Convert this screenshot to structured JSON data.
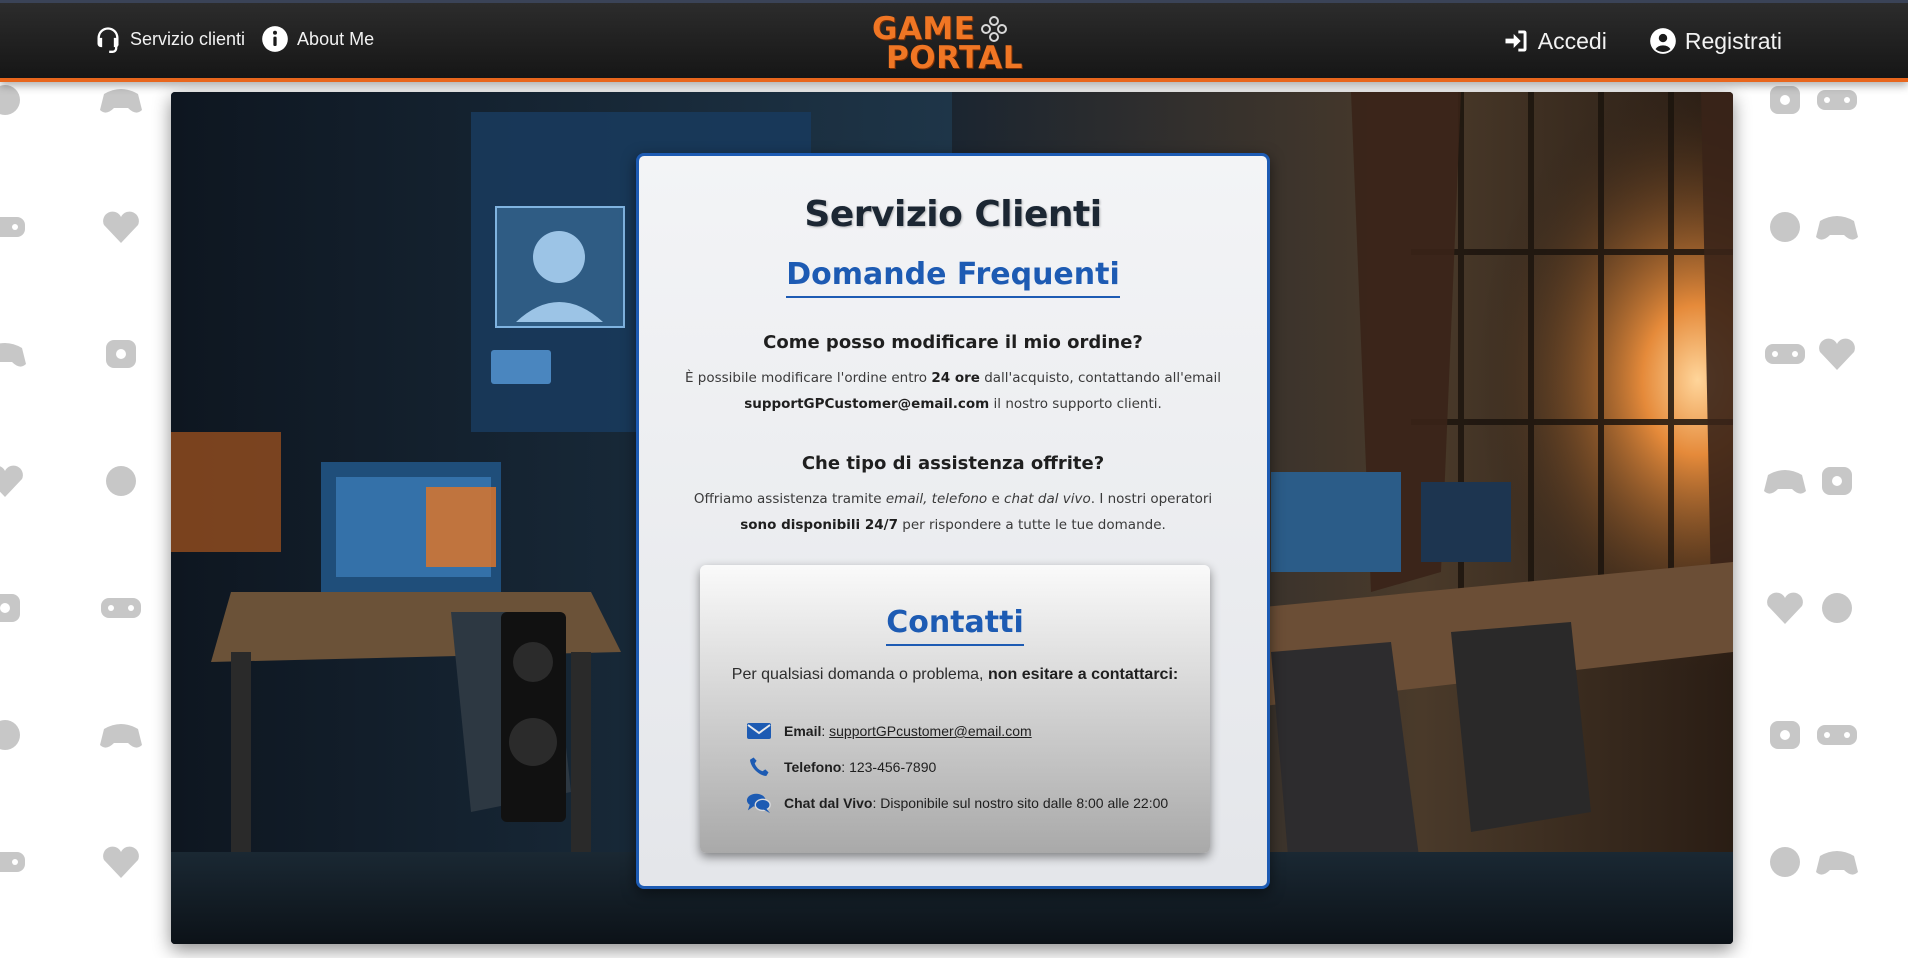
{
  "header": {
    "nav_left": [
      {
        "label": "Servizio clienti",
        "icon": "headset-icon"
      },
      {
        "label": "About Me",
        "icon": "info-icon"
      }
    ],
    "logo": {
      "line1": "GAME",
      "line2": "PORTAL"
    },
    "nav_right": [
      {
        "label": "Accedi",
        "icon": "sign-in-icon"
      },
      {
        "label": "Registrati",
        "icon": "user-circle-icon"
      }
    ]
  },
  "card": {
    "title": "Servizio Clienti",
    "faq_heading": "Domande Frequenti",
    "faq": [
      {
        "question": "Come posso modificare il mio ordine?",
        "answer_parts": [
          "È possibile modificare l'ordine entro ",
          "24 ore",
          " dall'acquisto, contattando all'email ",
          "supportGPCustomer@email.com",
          " il nostro supporto clienti."
        ]
      },
      {
        "question": "Che tipo di assistenza offrite?",
        "answer_parts": [
          "Offriamo assistenza tramite ",
          "email, telefono",
          " e ",
          "chat dal vivo",
          ". I nostri operatori ",
          "sono disponibili 24/7",
          " per rispondere a tutte le tue domande."
        ]
      }
    ],
    "contacts": {
      "heading": "Contatti",
      "intro": "Per qualsiasi domanda o problema, ",
      "intro_bold": "non esitare a contattarci:",
      "items": [
        {
          "label": "Email",
          "value": "supportGPcustomer@email.com",
          "icon": "envelope-icon"
        },
        {
          "label": "Telefono",
          "value": "123-456-7890",
          "icon": "phone-icon"
        },
        {
          "label": "Chat dal Vivo",
          "value": "Disponibile sul nostro sito dalle 8:00 alle 22:00",
          "icon": "chat-icon"
        }
      ]
    }
  },
  "colors": {
    "accent": "#1d5bb3",
    "header_border": "#e8661d",
    "logo": "#f07624"
  }
}
